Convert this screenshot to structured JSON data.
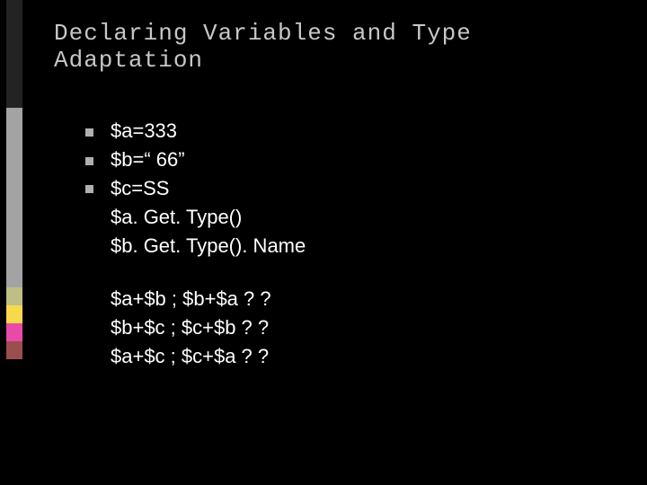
{
  "title": "Declaring Variables and Type Adaptation",
  "lines": {
    "l1": "$a=333",
    "l2": "$b=“ 66”",
    "l3": "$c=SS",
    "l4": "$a. Get. Type()",
    "l5": "$b. Get. Type(). Name",
    "l6": "$a+$b ; $b+$a ? ?",
    "l7": "$b+$c ; $c+$b ? ?",
    "l8": "$a+$c ; $c+$a ? ?"
  },
  "stripe": {
    "colors": [
      "#232323",
      "#a3a3a3",
      "#bdbf86",
      "#f8d94c",
      "#e84aa8",
      "#9b4e4e",
      "#000000"
    ],
    "heights": [
      120,
      200,
      20,
      20,
      20,
      20,
      140
    ]
  }
}
